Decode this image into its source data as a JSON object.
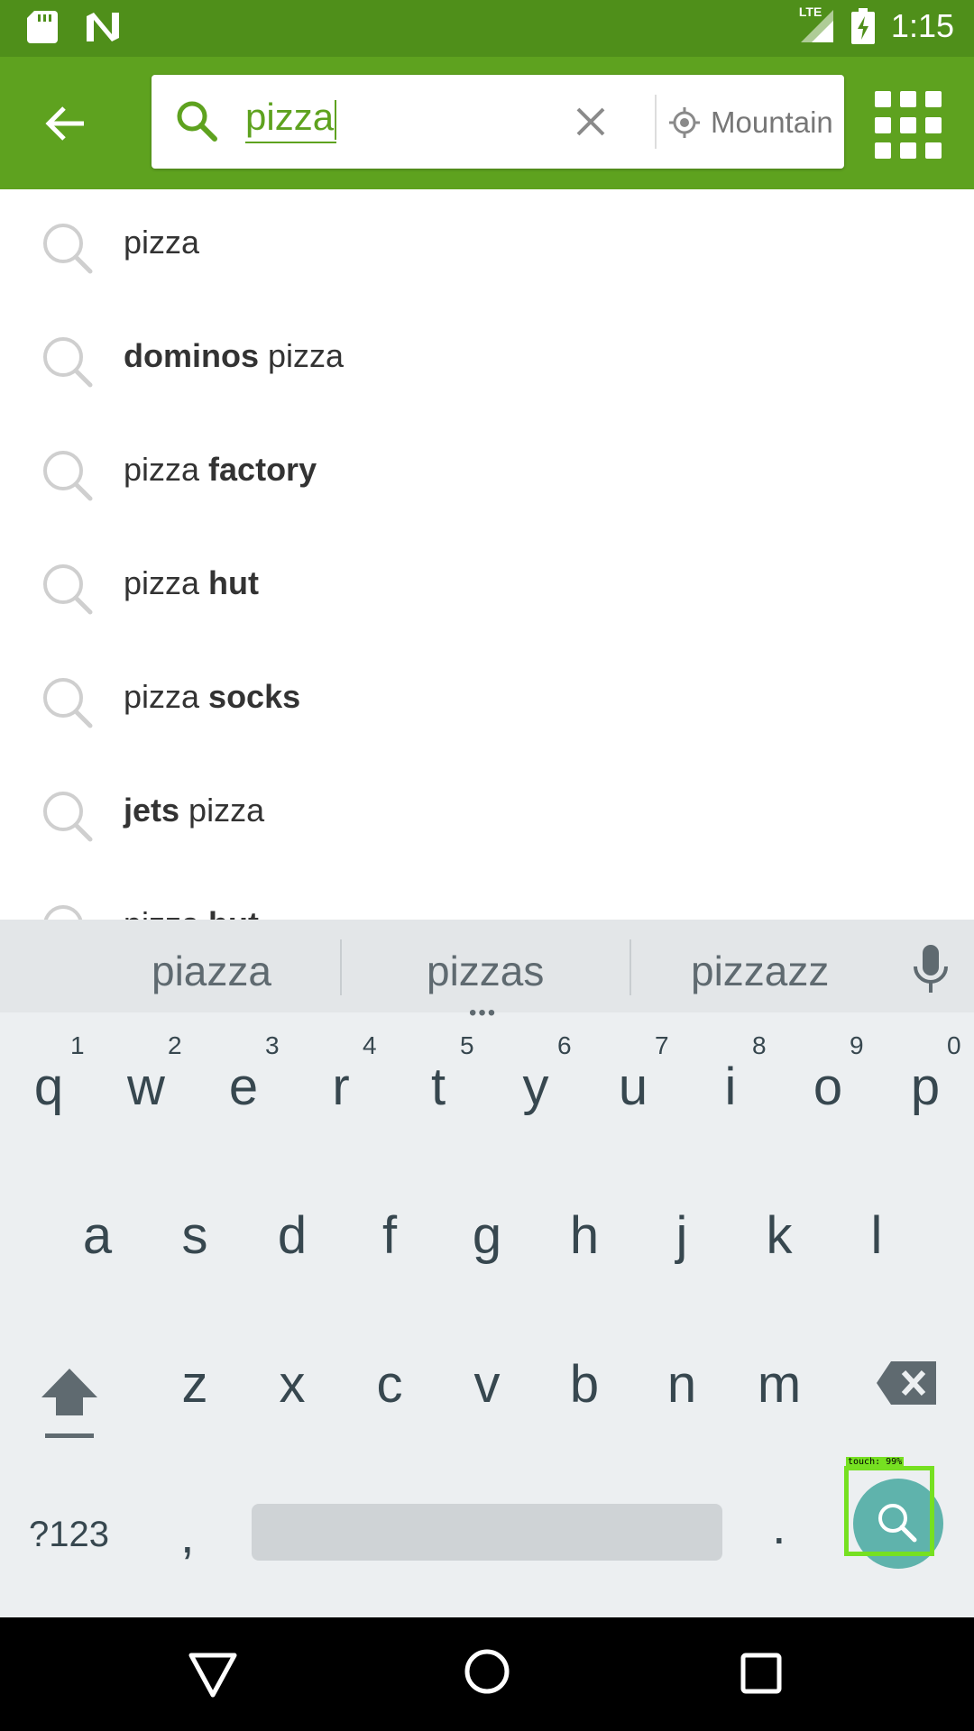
{
  "status_bar": {
    "time": "1:15",
    "network": "LTE",
    "colors": {
      "background": "#4f8f1a"
    }
  },
  "app_bar": {
    "colors": {
      "background": "#5ea21f",
      "accent": "#5ea21f"
    },
    "search": {
      "query": "pizza",
      "location": "Mountain View"
    }
  },
  "suggestions": [
    {
      "bold_prefix": "",
      "plain": "pizza",
      "bold_suffix": ""
    },
    {
      "bold_prefix": "dominos",
      "plain": " pizza",
      "bold_suffix": ""
    },
    {
      "bold_prefix": "",
      "plain": "pizza ",
      "bold_suffix": "factory"
    },
    {
      "bold_prefix": "",
      "plain": "pizza ",
      "bold_suffix": "hut"
    },
    {
      "bold_prefix": "",
      "plain": "pizza ",
      "bold_suffix": "socks"
    },
    {
      "bold_prefix": "jets",
      "plain": " pizza",
      "bold_suffix": ""
    },
    {
      "bold_prefix": "",
      "plain": "pizza ",
      "bold_suffix": "hut"
    }
  ],
  "keyboard": {
    "suggestions": [
      "piazza",
      "pizzas",
      "pizzazz"
    ],
    "row1": [
      {
        "k": "q",
        "h": "1"
      },
      {
        "k": "w",
        "h": "2"
      },
      {
        "k": "e",
        "h": "3"
      },
      {
        "k": "r",
        "h": "4"
      },
      {
        "k": "t",
        "h": "5"
      },
      {
        "k": "y",
        "h": "6"
      },
      {
        "k": "u",
        "h": "7"
      },
      {
        "k": "i",
        "h": "8"
      },
      {
        "k": "o",
        "h": "9"
      },
      {
        "k": "p",
        "h": "0"
      }
    ],
    "row2": [
      "a",
      "s",
      "d",
      "f",
      "g",
      "h",
      "j",
      "k",
      "l"
    ],
    "row3": [
      "z",
      "x",
      "c",
      "v",
      "b",
      "n",
      "m"
    ],
    "symbols_label": "?123",
    "comma": ",",
    "period": ".",
    "touch_label": "touch: 99%"
  }
}
